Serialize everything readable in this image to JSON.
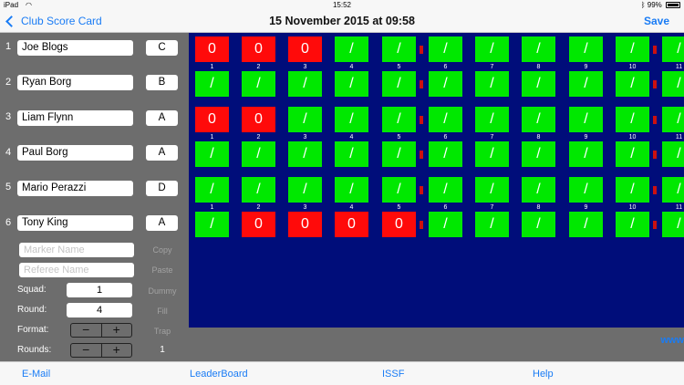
{
  "status": {
    "carrier": "iPad",
    "time": "15:52",
    "battery": "99%"
  },
  "nav": {
    "back_label": "Club Score Card",
    "title": "15 November 2015 at 09:58",
    "save_label": "Save"
  },
  "players": [
    {
      "num": "1",
      "name": "Joe Blogs",
      "grade": "C"
    },
    {
      "num": "2",
      "name": "Ryan Borg",
      "grade": "B"
    },
    {
      "num": "3",
      "name": "Liam Flynn",
      "grade": "A"
    },
    {
      "num": "4",
      "name": "Paul Borg",
      "grade": "A"
    },
    {
      "num": "5",
      "name": "Mario Perazzi",
      "grade": "D"
    },
    {
      "num": "6",
      "name": "Tony King",
      "grade": "A"
    }
  ],
  "officials": {
    "marker_placeholder": "Marker Name",
    "referee_placeholder": "Referee Name"
  },
  "side_actions": {
    "copy": "Copy",
    "paste": "Paste",
    "dummy": "Dummy",
    "fill": "Fill",
    "trap": "Trap"
  },
  "settings": {
    "squad_label": "Squad:",
    "squad_value": "1",
    "round_label": "Round:",
    "round_value": "4",
    "format_label": "Format:",
    "rounds_label": "Rounds:",
    "rounds_value": "1",
    "minus": "−",
    "plus": "+"
  },
  "scores": [
    [
      "0",
      "0",
      "0",
      "/",
      "/",
      "/",
      "/",
      "/",
      "/",
      "/",
      "/"
    ],
    [
      "/",
      "/",
      "/",
      "/",
      "/",
      "/",
      "/",
      "/",
      "/",
      "/",
      "/"
    ],
    [
      "0",
      "0",
      "/",
      "/",
      "/",
      "/",
      "/",
      "/",
      "/",
      "/",
      "/"
    ],
    [
      "/",
      "/",
      "/",
      "/",
      "/",
      "/",
      "/",
      "/",
      "/",
      "/",
      "/"
    ],
    [
      "/",
      "/",
      "/",
      "/",
      "/",
      "/",
      "/",
      "/",
      "/",
      "/",
      "/"
    ],
    [
      "/",
      "0",
      "0",
      "0",
      "0",
      "/",
      "/",
      "/",
      "/",
      "/",
      "/"
    ]
  ],
  "target_numbers": [
    "1",
    "2",
    "3",
    "4",
    "5",
    "6",
    "7",
    "8",
    "9",
    "10",
    "11"
  ],
  "grid_footer_link": "www",
  "tabs": [
    "E-Mail",
    "LeaderBoard",
    "ISSF",
    "Help"
  ],
  "colors": {
    "hit": "#00e800",
    "miss": "#ff0a0a",
    "grid_bg": "#000d7a",
    "accent": "#1a7cf5"
  }
}
